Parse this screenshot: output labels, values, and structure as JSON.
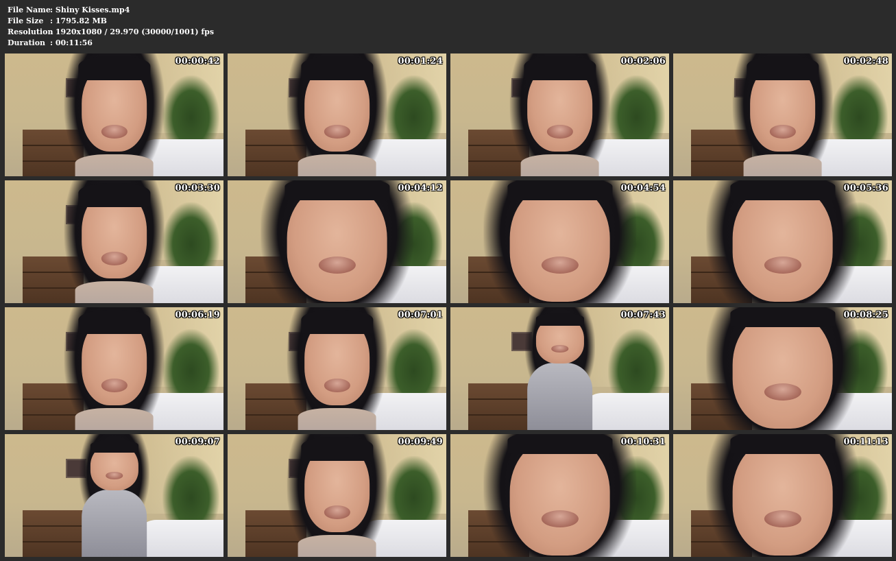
{
  "info": {
    "rows": [
      {
        "label": "File Name",
        "value": ": Shiny Kisses.mp4"
      },
      {
        "label": "File Size",
        "value": ": 1795.82 MB"
      },
      {
        "label": "Resolution",
        "value": ": 1920x1080 / 29.970 (30000/1001) fps"
      },
      {
        "label": "Duration",
        "value": ": 00:11:56"
      }
    ]
  },
  "thumbnails": [
    {
      "timestamp": "00:00:42"
    },
    {
      "timestamp": "00:01:24"
    },
    {
      "timestamp": "00:02:06"
    },
    {
      "timestamp": "00:02:48"
    },
    {
      "timestamp": "00:03:30"
    },
    {
      "timestamp": "00:04:12"
    },
    {
      "timestamp": "00:04:54"
    },
    {
      "timestamp": "00:05:36"
    },
    {
      "timestamp": "00:06:19"
    },
    {
      "timestamp": "00:07:01"
    },
    {
      "timestamp": "00:07:43"
    },
    {
      "timestamp": "00:08:25"
    },
    {
      "timestamp": "00:09:07"
    },
    {
      "timestamp": "00:09:49"
    },
    {
      "timestamp": "00:10:31"
    },
    {
      "timestamp": "00:11:13"
    }
  ]
}
